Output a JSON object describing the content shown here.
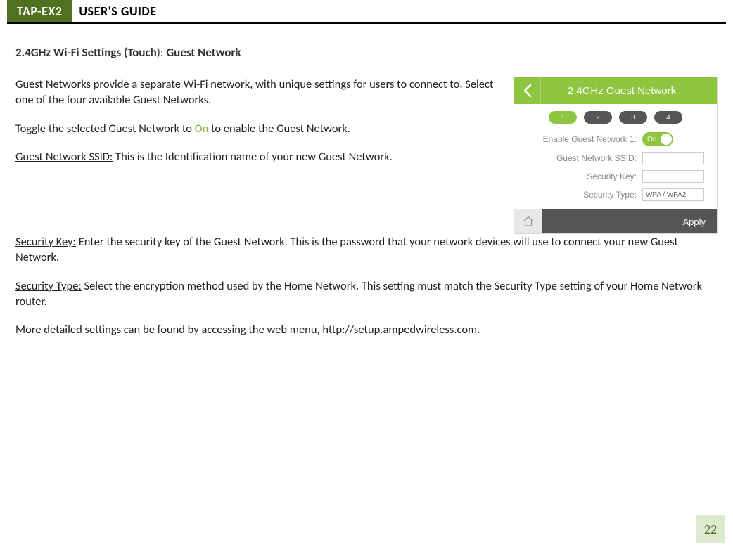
{
  "header": {
    "badge": "TAP-EX2",
    "title": "USER'S GUIDE"
  },
  "section_title": {
    "prefix_bold": "2.4GHz Wi-Fi Settings (Touch",
    "paren": "): ",
    "suffix_bold": "Guest Network"
  },
  "paragraphs": {
    "p1": "Guest Networks provide a separate Wi-Fi network, with unique settings for users to connect to.  Select one of the four available Guest Networks.",
    "p2_before": "Toggle the selected Guest Network to ",
    "p2_on": "On",
    "p2_after": " to enable the Guest Network.",
    "p3_label": "Guest Network SSID:",
    "p3_text": " This is the Identification name of your new Guest Network.",
    "p4_label": "Security Key:",
    "p4_text": " Enter the security key of the Guest Network. This is the password that your network devices will use to connect your new Guest Network.",
    "p5_label": "Security Type:",
    "p5_text": " Select the encryption method used by the Home Network. This setting must match the Security Type setting of your Home Network router.",
    "p6": "More detailed settings can be found by accessing the web menu, http://setup.ampedwireless.com."
  },
  "phone_ui": {
    "header_title": "2.4GHz Guest Network",
    "tabs": [
      "1",
      "2",
      "3",
      "4"
    ],
    "enable_label": "Enable Guest Network 1:",
    "toggle_value": "On",
    "ssid_label": "Guest Network SSID:",
    "key_label": "Security Key:",
    "type_label": "Security Type:",
    "type_value": "WPA / WPA2",
    "apply": "Apply"
  },
  "page_number": "22"
}
